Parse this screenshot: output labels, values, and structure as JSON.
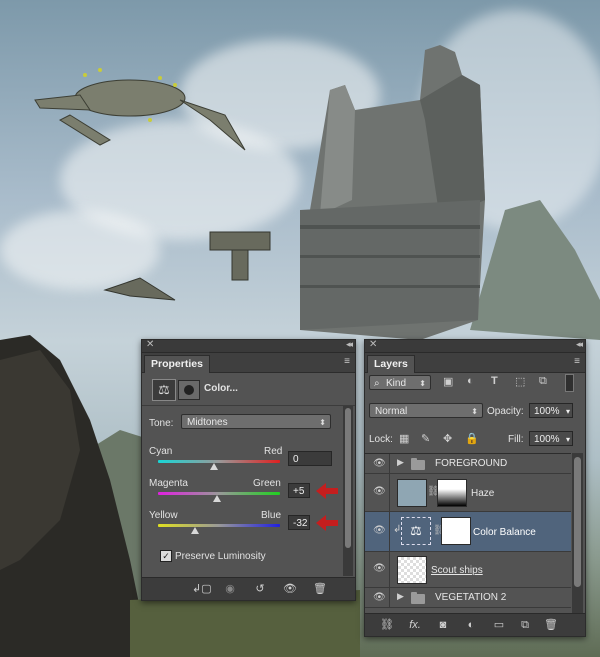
{
  "properties_panel": {
    "tab_title": "Properties",
    "adjustment_title": "Color...",
    "tone_label": "Tone:",
    "tone_value": "Midtones",
    "sliders": [
      {
        "left": "Cyan",
        "right": "Red",
        "value": "0",
        "fraction": 0.5
      },
      {
        "left": "Magenta",
        "right": "Green",
        "value": "+5",
        "fraction": 0.525
      },
      {
        "left": "Yellow",
        "right": "Blue",
        "value": "-32",
        "fraction": 0.34
      }
    ],
    "preserve_luminosity": "Preserve Luminosity",
    "preserve_checked": true
  },
  "layers_panel": {
    "tab_title": "Layers",
    "filter_kind": "Kind",
    "blend_mode": "Normal",
    "opacity_label": "Opacity:",
    "opacity_value": "100%",
    "lock_label": "Lock:",
    "fill_label": "Fill:",
    "fill_value": "100%",
    "layers": [
      {
        "name": "FOREGROUND",
        "type": "group"
      },
      {
        "name": "Haze",
        "type": "adjustment"
      },
      {
        "name": "Color Balance",
        "type": "adjustment",
        "selected": true
      },
      {
        "name": "Scout ships",
        "type": "pixel"
      },
      {
        "name": "VEGETATION 2",
        "type": "group"
      }
    ]
  },
  "colors": {
    "panel_bg": "#535353",
    "selection": "#50647c",
    "annotation_arrow": "#c41e1e"
  }
}
